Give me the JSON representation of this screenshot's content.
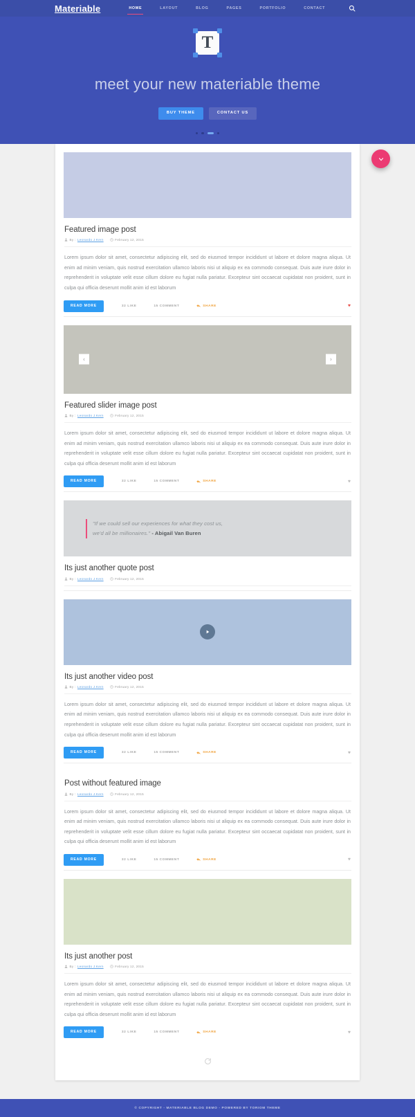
{
  "header": {
    "brand": "Materiable",
    "nav": [
      {
        "label": "HOME",
        "has_caret": false,
        "active": true
      },
      {
        "label": "LAYOUT",
        "has_caret": true,
        "active": false
      },
      {
        "label": "BLOG",
        "has_caret": true,
        "active": false
      },
      {
        "label": "PAGES",
        "has_caret": true,
        "active": false
      },
      {
        "label": "PORTFOLIO",
        "has_caret": true,
        "active": false
      },
      {
        "label": "CONTACT",
        "has_caret": true,
        "active": false
      }
    ],
    "search_icon": "search-icon"
  },
  "hero": {
    "logo_letter": "T",
    "title": "meet your new materiable theme",
    "buttons": {
      "primary": "BUY THEME",
      "secondary": "CONTACT US"
    },
    "dots": {
      "count": 4,
      "active_index": 2
    },
    "background_color": "#3f51b5"
  },
  "fab": {
    "icon": "chevron-down-icon",
    "color": "#ec3b73"
  },
  "labels": {
    "by": "By :",
    "read_more": "READ MORE",
    "share": "SHARE",
    "heart_icon": "heart-icon",
    "user_icon": "user-icon",
    "clock-icon": "clock-icon",
    "loading_icon": "loading-spinner-icon"
  },
  "posts": [
    {
      "media": "image",
      "thumb_class": "blue",
      "title": "Featured image post",
      "author": "Leonardo J.Kern",
      "date": "February 12, 2015",
      "excerpt": "Lorem ipsum dolor sit amet, consectetur adipiscing elit, sed do eiusmod tempor incididunt ut labore et dolore magna aliqua. Ut enim ad minim veniam, quis nostrud exercitation ullamco laboris nisi ut aliquip ex ea commodo consequat. Duis aute irure dolor in reprehenderit in voluptate velit esse cillum dolore eu fugiat nulla pariatur. Excepteur sint occaecat cupidatat non proident, sunt in culpa qui officia deserunt mollit anim id est laborum",
      "read_more": "READ MORE",
      "likes": "32 LIKE",
      "comments": "15 COMMENT",
      "share": "SHARE",
      "liked": true
    },
    {
      "media": "slider",
      "thumb_class": "grey",
      "title": "Featured slider image post",
      "author": "Leonardo J.Kern",
      "date": "February 12, 2015",
      "excerpt": "Lorem ipsum dolor sit amet, consectetur adipiscing elit, sed do eiusmod tempor incididunt ut labore et dolore magna aliqua. Ut enim ad minim veniam, quis nostrud exercitation ullamco laboris nisi ut aliquip ex ea commodo consequat. Duis aute irure dolor in reprehenderit in voluptate velit esse cillum dolore eu fugiat nulla pariatur. Excepteur sint occaecat cupidatat non proident, sunt in culpa qui officia deserunt mollit anim id est laborum",
      "read_more": "READ MORE",
      "likes": "32 LIKE",
      "comments": "15 COMMENT",
      "share": "SHARE",
      "liked": false,
      "prev_arrow": "‹",
      "next_arrow": "›"
    },
    {
      "media": "quote",
      "thumb_class": "quote",
      "quote_line1": "\"If we could sell our experiences for what they cost us,",
      "quote_line2_text": "we'd all be millionaires.\"",
      "quote_attribution": "- Abigail Van Buren",
      "title": "Its just another quote post",
      "author": "Leonardo J.Kern",
      "date": "February 12, 2015"
    },
    {
      "media": "video",
      "thumb_class": "video",
      "title": "Its just another video post",
      "author": "Leonardo J.Kern",
      "date": "February 12, 2015",
      "excerpt": "Lorem ipsum dolor sit amet, consectetur adipiscing elit, sed do eiusmod tempor incididunt ut labore et dolore magna aliqua. Ut enim ad minim veniam, quis nostrud exercitation ullamco laboris nisi ut aliquip ex ea commodo consequat. Duis aute irure dolor in reprehenderit in voluptate velit esse cillum dolore eu fugiat nulla pariatur. Excepteur sint occaecat cupidatat non proident, sunt in culpa qui officia deserunt mollit anim id est laborum",
      "read_more": "READ MORE",
      "likes": "32 LIKE",
      "comments": "15 COMMENT",
      "share": "SHARE",
      "liked": false
    },
    {
      "media": "none",
      "title": "Post without featured image",
      "author": "Leonardo J.Kern",
      "date": "February 12, 2015",
      "excerpt": "Lorem ipsum dolor sit amet, consectetur adipiscing elit, sed do eiusmod tempor incididunt ut labore et dolore magna aliqua. Ut enim ad minim veniam, quis nostrud exercitation ullamco laboris nisi ut aliquip ex ea commodo consequat. Duis aute irure dolor in reprehenderit in voluptate velit esse cillum dolore eu fugiat nulla pariatur. Excepteur sint occaecat cupidatat non proident, sunt in culpa qui officia deserunt mollit anim id est laborum",
      "read_more": "READ MORE",
      "likes": "32 LIKE",
      "comments": "15 COMMENT",
      "share": "SHARE",
      "liked": false
    },
    {
      "media": "image",
      "thumb_class": "green",
      "title": "Its just another post",
      "author": "Leonardo J.Kern",
      "date": "February 12, 2015",
      "excerpt": "Lorem ipsum dolor sit amet, consectetur adipiscing elit, sed do eiusmod tempor incididunt ut labore et dolore magna aliqua. Ut enim ad minim veniam, quis nostrud exercitation ullamco laboris nisi ut aliquip ex ea commodo consequat. Duis aute irure dolor in reprehenderit in voluptate velit esse cillum dolore eu fugiat nulla pariatur. Excepteur sint occaecat cupidatat non proident, sunt in culpa qui officia deserunt mollit anim id est laborum",
      "read_more": "READ MORE",
      "likes": "32 LIKE",
      "comments": "15 COMMENT",
      "share": "SHARE",
      "liked": false
    }
  ],
  "footer": {
    "text": "© COPYRIGHT - MATERIABLE BLOG DEMO - POWERED BY TORIOM THEME"
  }
}
